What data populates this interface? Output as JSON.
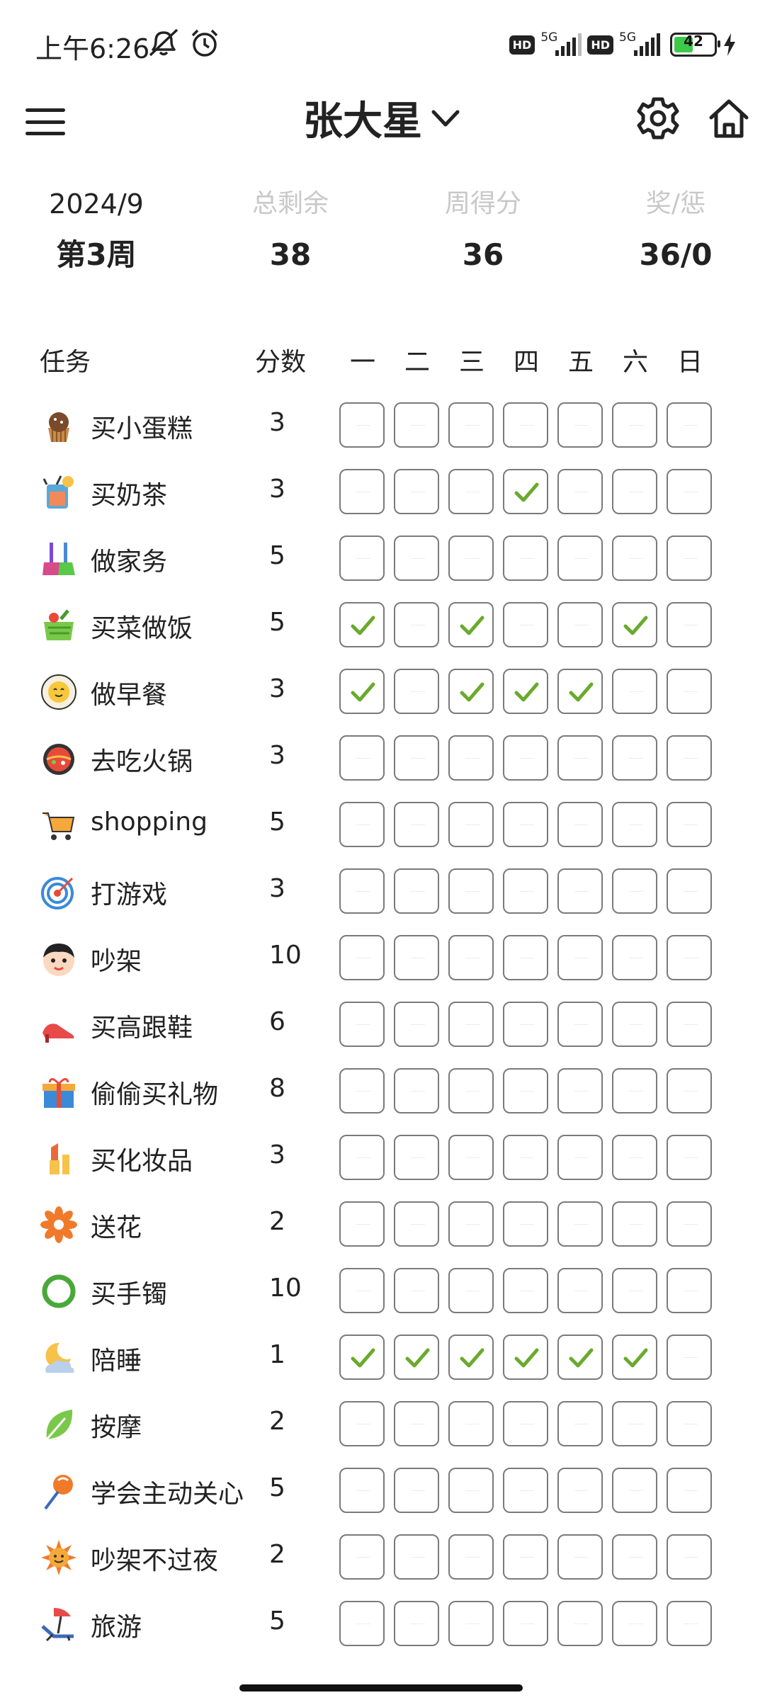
{
  "status_bar": {
    "time": "上午6:26",
    "network_1": "5G",
    "network_2": "5G",
    "hd_1": "HD",
    "hd_2": "HD",
    "battery": "42"
  },
  "header": {
    "title": "张大星"
  },
  "summary": {
    "month": "2024/9",
    "week": "第3周",
    "total_remaining_label": "总剩余",
    "total_remaining": "38",
    "weekly_score_label": "周得分",
    "weekly_score": "36",
    "reward_penalty_label": "奖/惩",
    "reward_penalty": "36/0"
  },
  "table": {
    "task_header": "任务",
    "score_header": "分数",
    "days": [
      "一",
      "二",
      "三",
      "四",
      "五",
      "六",
      "日"
    ],
    "rows": [
      {
        "icon": "cupcake-icon",
        "name": "买小蛋糕",
        "score": "3",
        "checks": [
          0,
          0,
          0,
          0,
          0,
          0,
          0
        ]
      },
      {
        "icon": "milk-tea-icon",
        "name": "买奶茶",
        "score": "3",
        "checks": [
          0,
          0,
          0,
          1,
          0,
          0,
          0
        ]
      },
      {
        "icon": "cleaning-tools-icon",
        "name": "做家务",
        "score": "5",
        "checks": [
          0,
          0,
          0,
          0,
          0,
          0,
          0
        ]
      },
      {
        "icon": "vegetable-basket-icon",
        "name": "买菜做饭",
        "score": "5",
        "checks": [
          1,
          0,
          1,
          0,
          0,
          1,
          0
        ]
      },
      {
        "icon": "fried-egg-icon",
        "name": "做早餐",
        "score": "3",
        "checks": [
          1,
          0,
          1,
          1,
          1,
          0,
          0
        ]
      },
      {
        "icon": "hotpot-icon",
        "name": "去吃火锅",
        "score": "3",
        "checks": [
          0,
          0,
          0,
          0,
          0,
          0,
          0
        ]
      },
      {
        "icon": "shopping-cart-icon",
        "name": "shopping",
        "score": "5",
        "checks": [
          0,
          0,
          0,
          0,
          0,
          0,
          0
        ]
      },
      {
        "icon": "target-icon",
        "name": "打游戏",
        "score": "3",
        "checks": [
          0,
          0,
          0,
          0,
          0,
          0,
          0
        ]
      },
      {
        "icon": "boy-face-icon",
        "name": "吵架",
        "score": "10",
        "checks": [
          0,
          0,
          0,
          0,
          0,
          0,
          0
        ]
      },
      {
        "icon": "high-heel-icon",
        "name": "买高跟鞋",
        "score": "6",
        "checks": [
          0,
          0,
          0,
          0,
          0,
          0,
          0
        ]
      },
      {
        "icon": "gift-icon",
        "name": "偷偷买礼物",
        "score": "8",
        "checks": [
          0,
          0,
          0,
          0,
          0,
          0,
          0
        ]
      },
      {
        "icon": "lipstick-icon",
        "name": "买化妆品",
        "score": "3",
        "checks": [
          0,
          0,
          0,
          0,
          0,
          0,
          0
        ]
      },
      {
        "icon": "flower-icon",
        "name": "送花",
        "score": "2",
        "checks": [
          0,
          0,
          0,
          0,
          0,
          0,
          0
        ]
      },
      {
        "icon": "bracelet-icon",
        "name": "买手镯",
        "score": "10",
        "checks": [
          0,
          0,
          0,
          0,
          0,
          0,
          0
        ]
      },
      {
        "icon": "moon-cloud-icon",
        "name": "陪睡",
        "score": "1",
        "checks": [
          1,
          1,
          1,
          1,
          1,
          1,
          0
        ]
      },
      {
        "icon": "leaf-icon",
        "name": "按摩",
        "score": "2",
        "checks": [
          0,
          0,
          0,
          0,
          0,
          0,
          0
        ]
      },
      {
        "icon": "lollipop-icon",
        "name": "学会主动关心",
        "score": "5",
        "checks": [
          0,
          0,
          0,
          0,
          0,
          0,
          0
        ]
      },
      {
        "icon": "sun-icon",
        "name": "吵架不过夜",
        "score": "2",
        "checks": [
          0,
          0,
          0,
          0,
          0,
          0,
          0
        ]
      },
      {
        "icon": "beach-chair-icon",
        "name": "旅游",
        "score": "5",
        "checks": [
          0,
          0,
          0,
          0,
          0,
          0,
          0
        ]
      }
    ]
  },
  "colors": {
    "check": "#6aaa2c",
    "cell_border": "#7a7a7a",
    "muted_label": "#c8c8c8"
  }
}
